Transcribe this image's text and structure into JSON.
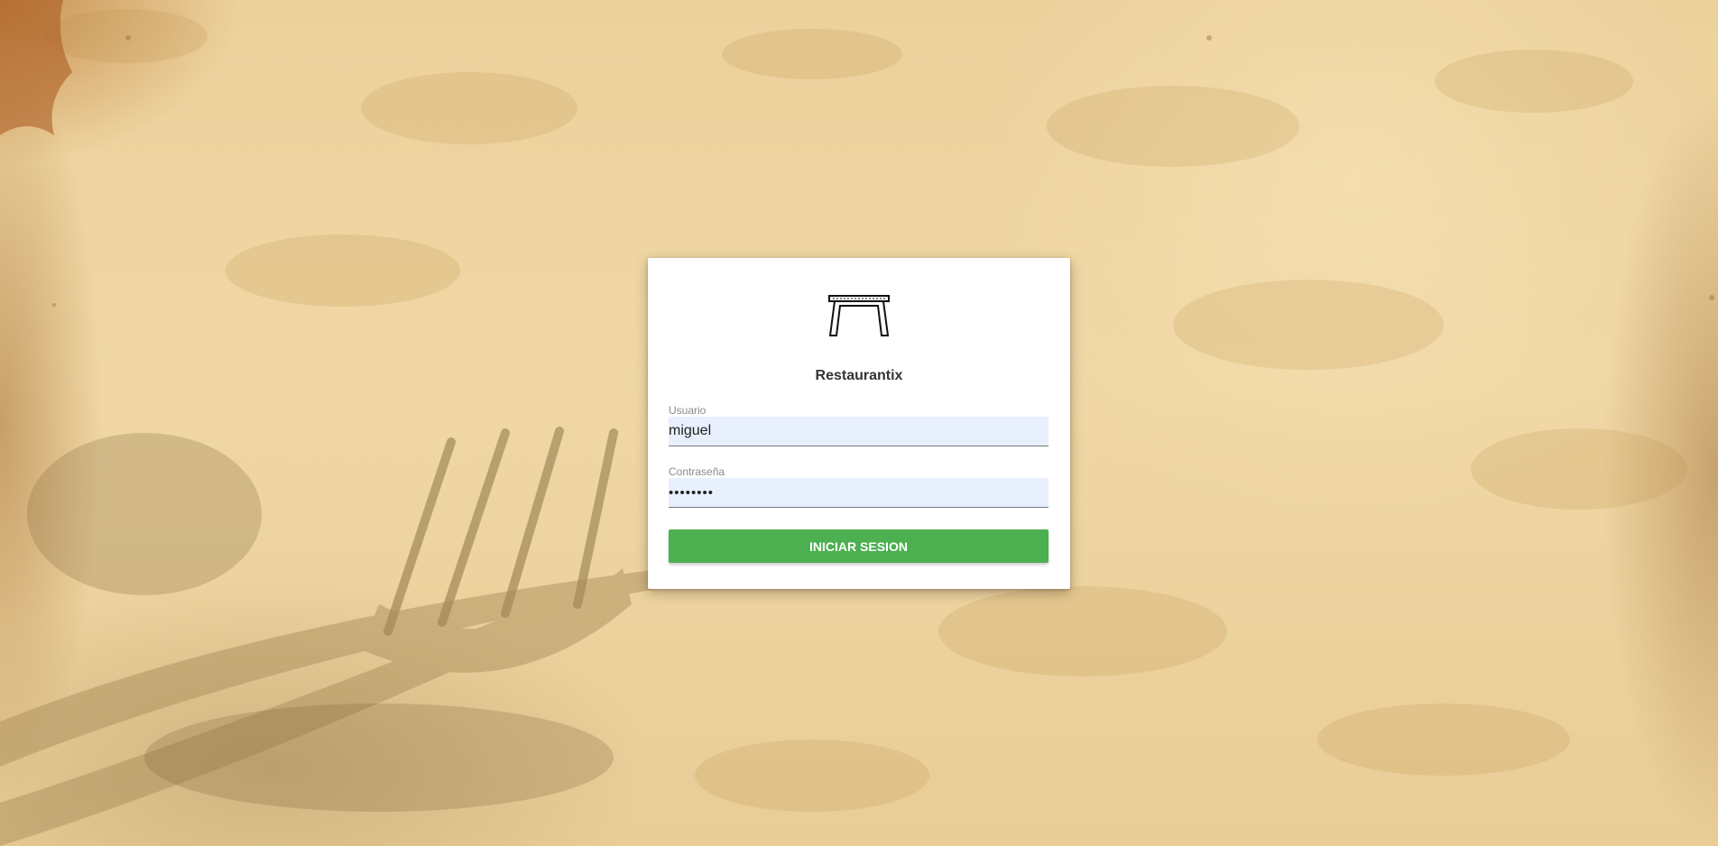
{
  "app": {
    "title": "Restaurantix",
    "logo_icon": "table-icon"
  },
  "form": {
    "username": {
      "label": "Usuario",
      "value": "miguel"
    },
    "password": {
      "label": "Contraseña",
      "value": "••••••••"
    },
    "submit_label": "INICIAR SESION"
  },
  "colors": {
    "button": "#4caf50",
    "input_background": "#e8f0fe",
    "card": "#ffffff",
    "background": "#f0d7a4"
  }
}
